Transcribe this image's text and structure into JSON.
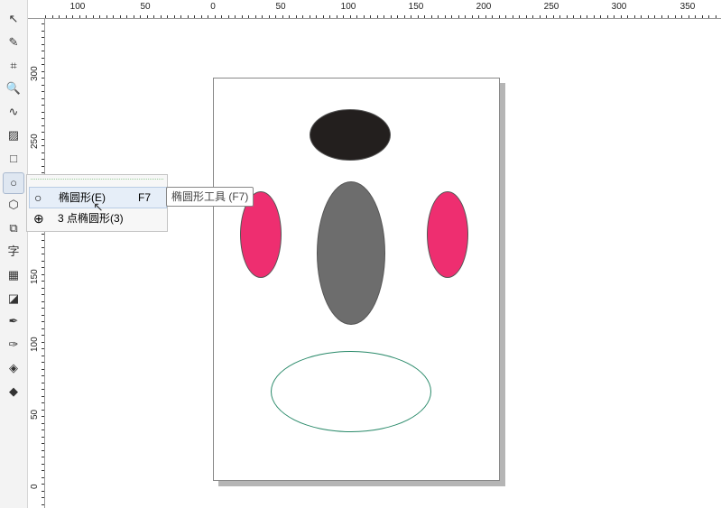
{
  "ruler": {
    "h_labels": [
      "100",
      "50",
      "0",
      "50",
      "100",
      "150",
      "200",
      "250",
      "300",
      "350"
    ],
    "v_labels": [
      "300",
      "250",
      "200",
      "150",
      "100",
      "50",
      "0"
    ]
  },
  "toolbox": {
    "tools": [
      {
        "name": "pick-tool-icon",
        "glyph": "↖"
      },
      {
        "name": "shape-tool-icon",
        "glyph": "✎"
      },
      {
        "name": "crop-tool-icon",
        "glyph": "⌗"
      },
      {
        "name": "zoom-tool-icon",
        "glyph": "🔍"
      },
      {
        "name": "freehand-tool-icon",
        "glyph": "∿"
      },
      {
        "name": "smart-fill-icon",
        "glyph": "▨"
      },
      {
        "name": "rectangle-tool-icon",
        "glyph": "□"
      },
      {
        "name": "ellipse-tool-icon",
        "glyph": "○"
      },
      {
        "name": "polygon-tool-icon",
        "glyph": "⬡"
      },
      {
        "name": "basic-shapes-icon",
        "glyph": "⧉"
      },
      {
        "name": "text-tool-icon",
        "glyph": "字"
      },
      {
        "name": "table-tool-icon",
        "glyph": "▦"
      },
      {
        "name": "blend-tool-icon",
        "glyph": "◪"
      },
      {
        "name": "eyedropper-icon",
        "glyph": "✒"
      },
      {
        "name": "outline-pen-icon",
        "glyph": "✑"
      },
      {
        "name": "fill-tool-icon",
        "glyph": "◈"
      },
      {
        "name": "interactive-fill-icon",
        "glyph": "◆"
      }
    ]
  },
  "flyout": {
    "items": [
      {
        "label": "椭圆形(E)",
        "shortcut": "F7"
      },
      {
        "label": "3 点椭圆形(3)",
        "shortcut": ""
      }
    ]
  },
  "tooltip": "椭圆形工具 (F7)",
  "colors": {
    "black_fill": "#231f1e",
    "gray_fill": "#6d6d6d",
    "pink_fill": "#ee2e70",
    "outline_green": "#2a8a6a"
  }
}
